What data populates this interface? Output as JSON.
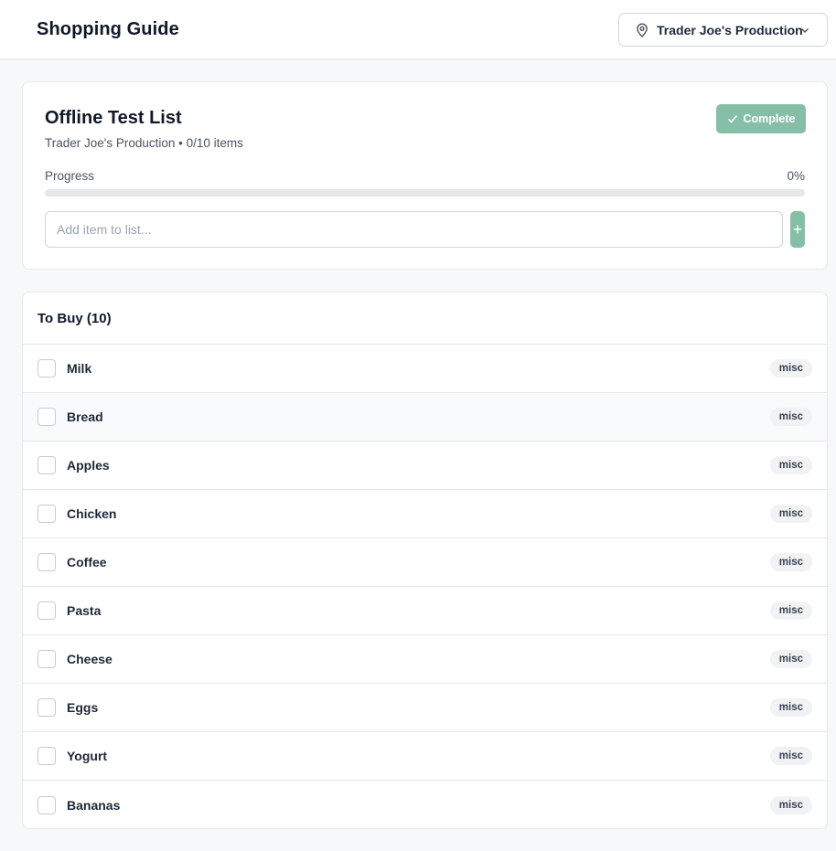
{
  "header": {
    "title": "Shopping Guide",
    "store_selector": {
      "label": "Trader Joe's Production",
      "icon": "map-pin-icon",
      "chevron": "chevron-down-icon"
    }
  },
  "list": {
    "title": "Offline Test List",
    "subtitle": "Trader Joe's Production • 0/10 items",
    "complete_label": "Complete",
    "progress_label": "Progress",
    "progress_percent_text": "0%",
    "progress_value": 0,
    "add_placeholder": "Add item to list...",
    "add_button_label": "+"
  },
  "to_buy": {
    "heading": "To Buy (10)",
    "items": [
      {
        "name": "Milk",
        "category": "misc"
      },
      {
        "name": "Bread",
        "category": "misc"
      },
      {
        "name": "Apples",
        "category": "misc"
      },
      {
        "name": "Chicken",
        "category": "misc"
      },
      {
        "name": "Coffee",
        "category": "misc"
      },
      {
        "name": "Pasta",
        "category": "misc"
      },
      {
        "name": "Cheese",
        "category": "misc"
      },
      {
        "name": "Eggs",
        "category": "misc"
      },
      {
        "name": "Yogurt",
        "category": "misc"
      },
      {
        "name": "Bananas",
        "category": "misc"
      }
    ]
  },
  "colors": {
    "accent": "#86bfa8",
    "background": "#f7f8fa",
    "border": "#e5e7eb"
  }
}
